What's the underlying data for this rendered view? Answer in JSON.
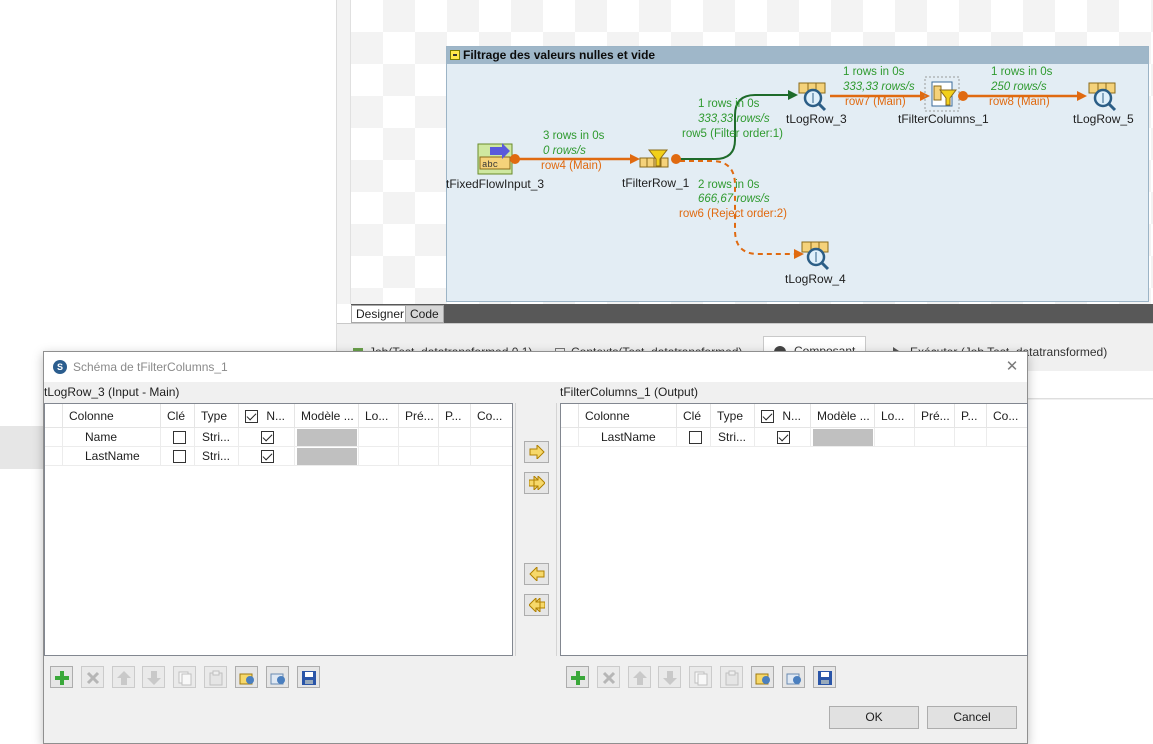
{
  "subjob": {
    "title": "Filtrage des valeurs nulles et vide"
  },
  "components": {
    "fixed_flow": "tFixedFlowInput_3",
    "filter_row": "tFilterRow_1",
    "log_row_3": "tLogRow_3",
    "log_row_4": "tLogRow_4",
    "filter_columns": "tFilterColumns_1",
    "log_row_5": "tLogRow_5",
    "fixed_flow_icon_text": "abc"
  },
  "flows": {
    "row4": {
      "rows": "3 rows in 0s",
      "rate": "0 rows/s",
      "name": "row4 (Main)"
    },
    "row5": {
      "rows": "1 rows in 0s",
      "rate": "333,33 rows/s",
      "name": "row5 (Filter order:1)"
    },
    "row6": {
      "rows": "2 rows in 0s",
      "rate": "666,67 rows/s",
      "name": "row6 (Reject order:2)"
    },
    "row7": {
      "rows": "1 rows in 0s",
      "rate": "333,33 rows/s",
      "name": "row7 (Main)"
    },
    "row8": {
      "rows": "1 rows in 0s",
      "rate": "250 rows/s",
      "name": "row8 (Main)"
    }
  },
  "designer_tabs": [
    "Designer",
    "Code"
  ],
  "bottom_tabs": {
    "job": "Job(Test_datatransformed 0.1)",
    "contexts": "Contexts(Test_datatransformed)",
    "component": "Composant",
    "run": "Exécuter (Job Test_datatransformed)"
  },
  "dialog": {
    "title": "Schéma de tFilterColumns_1",
    "close": "✕",
    "input_label": "tLogRow_3 (Input - Main)",
    "output_label": "tFilterColumns_1 (Output)",
    "columns": [
      "Colonne",
      "Clé",
      "Type",
      "N...",
      "Modèle ...",
      "Lo...",
      "Pré...",
      "P...",
      "Co..."
    ],
    "input_rows": [
      {
        "colonne": "Name",
        "cle": false,
        "type": "Stri...",
        "nullable": true
      },
      {
        "colonne": "LastName",
        "cle": false,
        "type": "Stri...",
        "nullable": true
      }
    ],
    "output_rows": [
      {
        "colonne": "LastName",
        "cle": false,
        "type": "Stri...",
        "nullable": true
      }
    ],
    "ok_label": "OK",
    "cancel_label": "Cancel"
  },
  "colors": {
    "main_flow": "#e06a10",
    "filter_flow": "#1e6b2a",
    "stats_text": "#2f9a2f",
    "subjob_bg": "#e3edf4",
    "subjob_header": "#9fb7c9"
  }
}
